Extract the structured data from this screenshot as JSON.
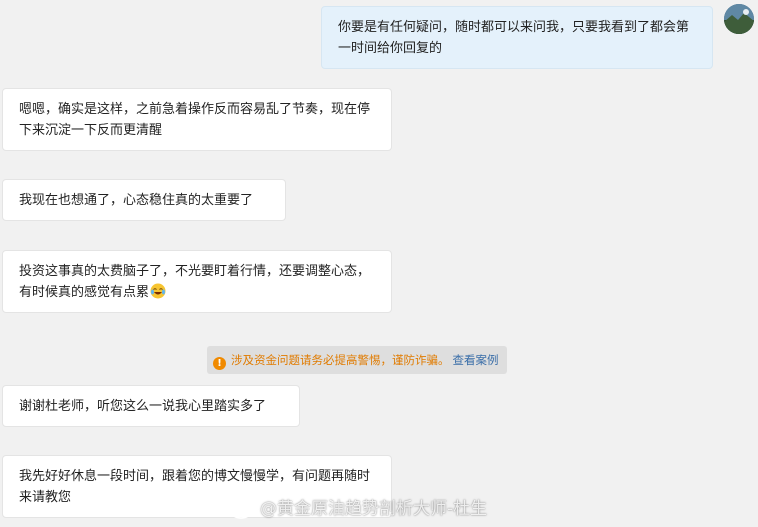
{
  "messages": [
    {
      "side": "out",
      "text": "你要是有任何疑问，随时都可以来问我，只要我看到了都会第一时间给你回复的"
    },
    {
      "side": "in",
      "text": "嗯嗯，确实是这样，之前急着操作反而容易乱了节奏，现在停下来沉淀一下反而更清醒"
    },
    {
      "side": "in",
      "text": "我现在也想通了，心态稳住真的太重要了"
    },
    {
      "side": "in",
      "text": "投资这事真的太费脑子了，不光要盯着行情，还要调整心态，有时候真的感觉有点累",
      "emoji": "laugh-cry-emoji"
    },
    {
      "side": "in",
      "text": "谢谢杜老师，听您这么一说我心里踏实多了"
    },
    {
      "side": "in",
      "text": "我先好好休息一段时间，跟着您的博文慢慢学，有问题再随时来请教您"
    }
  ],
  "notice": {
    "icon": "info-icon",
    "warning": "涉及资金问题请务必提高警惕，谨防诈骗。",
    "link": "查看案例",
    "warning_color": "#e07b00",
    "link_color": "#3a6ea8"
  },
  "watermark": {
    "icon": "weibo-icon",
    "text": "@黄金原油趋势剖析大师-杜生"
  },
  "colors": {
    "background": "#f1f1f1",
    "incoming_bubble": "#ffffff",
    "outgoing_bubble": "#e4f1fb"
  }
}
